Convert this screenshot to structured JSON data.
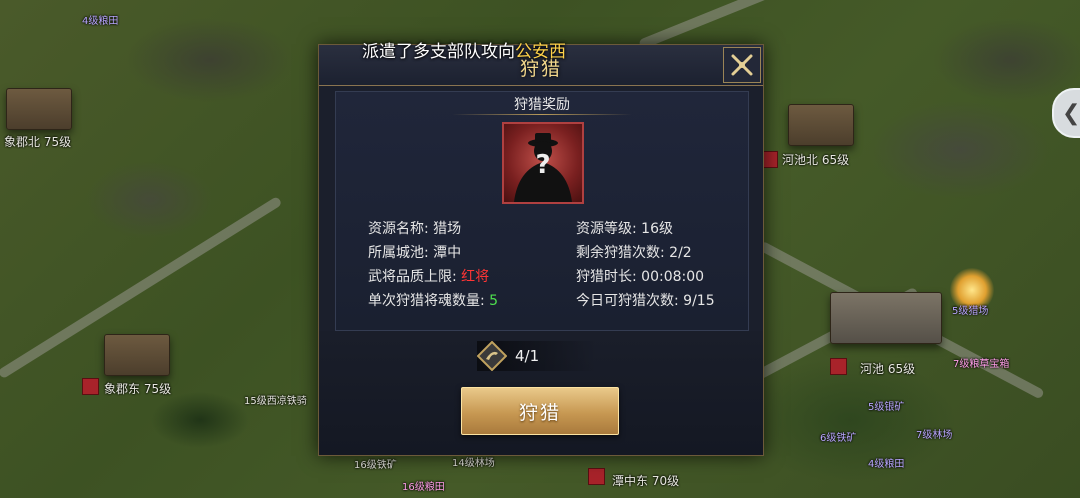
{
  "scroll_message": {
    "prefix": "派遣了多支部队攻向",
    "highlight": "公安西"
  },
  "map": {
    "labels": [
      {
        "text": "4级粮田"
      },
      {
        "text": "象郡北 75级"
      },
      {
        "text": "河池北 65级"
      },
      {
        "text": "象郡东 75级"
      },
      {
        "text": "15级西凉铁骑"
      },
      {
        "text": "河池 65级"
      },
      {
        "text": "5级猎场"
      },
      {
        "text": "7级粮草宝箱"
      },
      {
        "text": "5级银矿"
      },
      {
        "text": "6级铁矿"
      },
      {
        "text": "7级林场"
      },
      {
        "text": "4级粮田"
      },
      {
        "text": "潭中东 70级"
      },
      {
        "text": "16级铁矿"
      },
      {
        "text": "14级林场"
      },
      {
        "text": "16级粮田"
      }
    ]
  },
  "dialog": {
    "title": "狩猎",
    "section_title": "狩猎奖励",
    "portrait_symbol": "?",
    "info": {
      "resource_name_label": "资源名称:",
      "resource_name_value": "猎场",
      "resource_level_label": "资源等级:",
      "resource_level_value": "16级",
      "city_label": "所属城池:",
      "city_value": "潭中",
      "remaining_label": "剩余狩猎次数:",
      "remaining_value": "2/2",
      "quality_label": "武将品质上限:",
      "quality_value": "红将",
      "duration_label": "狩猎时长:",
      "duration_value": "00:08:00",
      "souls_label": "单次狩猎将魂数量:",
      "souls_value": "5",
      "today_label": "今日可狩猎次数:",
      "today_value": "9/15"
    },
    "cost_value": "4/1",
    "hunt_button": "狩猎"
  },
  "colors": {
    "title_gold": "#f3d88c",
    "quality_red": "#ff3535",
    "souls_green": "#4ee04e",
    "highlight_yellow": "#ffd24a"
  }
}
